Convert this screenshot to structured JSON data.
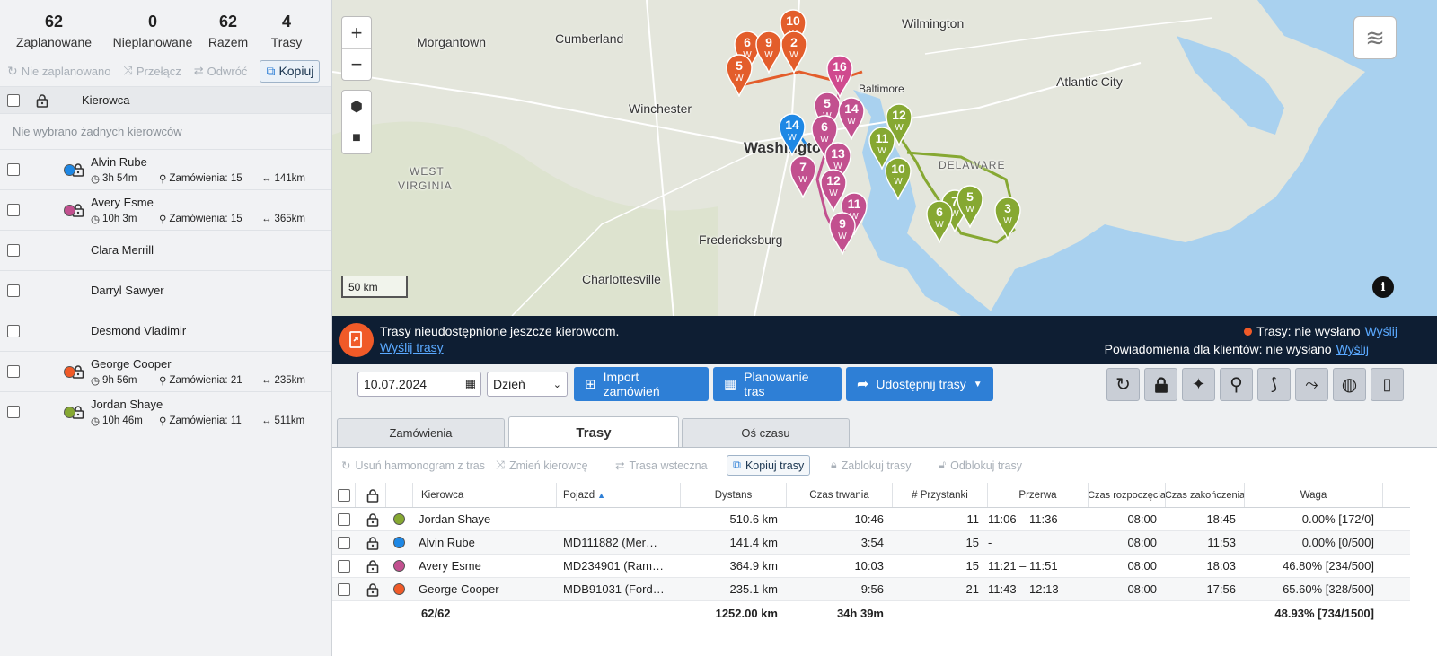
{
  "stats": [
    {
      "value": "62",
      "label": "Zaplanowane"
    },
    {
      "value": "0",
      "label": "Nieplanowane"
    },
    {
      "value": "62",
      "label": "Razem"
    },
    {
      "value": "4",
      "label": "Trasy"
    }
  ],
  "left_toolbar": {
    "unplan": "Nie zaplanowano",
    "toggle": "Przełącz",
    "reverse": "Odwróć",
    "copy": "Kopiuj"
  },
  "left_header": {
    "driver": "Kierowca"
  },
  "no_drivers_msg": "Nie wybrano żadnych kierowców",
  "drivers": [
    {
      "name": "Alvin Rube",
      "color": "#1e88e5",
      "time": "3h 54m",
      "orders": "Zamówienia: 15",
      "dist": "141km"
    },
    {
      "name": "Avery Esme",
      "color": "#c2508f",
      "time": "10h 3m",
      "orders": "Zamówienia: 15",
      "dist": "365km"
    },
    {
      "name": "Clara Merrill"
    },
    {
      "name": "Darryl Sawyer"
    },
    {
      "name": "Desmond Vladimir"
    },
    {
      "name": "George Cooper",
      "color": "#f05a28",
      "time": "9h 56m",
      "orders": "Zamówienia: 21",
      "dist": "235km"
    },
    {
      "name": "Jordan Shaye",
      "color": "#86a832",
      "time": "10h 46m",
      "orders": "Zamówienia: 11",
      "dist": "511km"
    }
  ],
  "map": {
    "cities": [
      "Wilmington",
      "Morgantown",
      "Cumberland",
      "Atlantic City",
      "Winchester",
      "Washington",
      "WEST",
      "VIRGINIA",
      "DELAWARE",
      "Fredericksburg",
      "Charlottesville",
      "Baltimore"
    ],
    "scale": "50 km",
    "pins": [
      {
        "n": "10",
        "c": "#e35d2b"
      },
      {
        "n": "6",
        "c": "#e35d2b"
      },
      {
        "n": "9",
        "c": "#e35d2b"
      },
      {
        "n": "2",
        "c": "#e35d2b"
      },
      {
        "n": "5",
        "c": "#e35d2b"
      },
      {
        "n": "16",
        "c": "#d04a8e"
      },
      {
        "n": "5",
        "c": "#c2508f"
      },
      {
        "n": "14",
        "c": "#c2508f"
      },
      {
        "n": "6",
        "c": "#c2508f"
      },
      {
        "n": "13",
        "c": "#c2508f"
      },
      {
        "n": "7",
        "c": "#c2508f"
      },
      {
        "n": "12",
        "c": "#c2508f"
      },
      {
        "n": "11",
        "c": "#c2508f"
      },
      {
        "n": "9",
        "c": "#c2508f"
      },
      {
        "n": "14",
        "c": "#1e88e5"
      },
      {
        "n": "12",
        "c": "#86a832"
      },
      {
        "n": "11",
        "c": "#86a832"
      },
      {
        "n": "10",
        "c": "#86a832"
      },
      {
        "n": "7",
        "c": "#86a832"
      },
      {
        "n": "5",
        "c": "#86a832"
      },
      {
        "n": "6",
        "c": "#86a832"
      },
      {
        "n": "3",
        "c": "#86a832"
      }
    ],
    "pin_sub": "W"
  },
  "banner": {
    "msg": "Trasy nieudostępnione jeszcze kierowcom.",
    "send_routes": "Wyślij trasy",
    "routes_status": "Trasy: nie wysłano",
    "send": "Wyślij",
    "notif_status": "Powiadomienia dla klientów: nie wysłano",
    "send2": "Wyślij"
  },
  "controls": {
    "date": "10.07.2024",
    "period": "Dzień",
    "import": "Import zamówień",
    "plan": "Planowanie tras",
    "share": "Udostępnij trasy"
  },
  "tabs": [
    "Zamówienia",
    "Trasy",
    "Oś czasu"
  ],
  "route_toolbar": {
    "unschedule": "Usuń harmonogram z tras",
    "change_driver": "Zmień kierowcę",
    "reverse": "Trasa wsteczna",
    "copy": "Kopiuj trasy",
    "lock": "Zablokuj trasy",
    "unlock": "Odblokuj trasy"
  },
  "table": {
    "headers": [
      "Kierowca",
      "Pojazd",
      "Dystans",
      "Czas trwania",
      "# Przystanki",
      "Przerwa",
      "Czas rozpoczęcia",
      "Czas zakończenia",
      "Waga"
    ],
    "rows": [
      {
        "color": "#86a832",
        "driver": "Jordan Shaye",
        "vehicle": "",
        "dist": "510.6 km",
        "dur": "10:46",
        "stops": "11",
        "brk": "11:06 – 11:36",
        "start": "08:00",
        "end": "18:45",
        "weight": "0.00% [172/0]"
      },
      {
        "color": "#1e88e5",
        "driver": "Alvin Rube",
        "vehicle": "MD111882 (Mer…",
        "dist": "141.4 km",
        "dur": "3:54",
        "stops": "15",
        "brk": "-",
        "start": "08:00",
        "end": "11:53",
        "weight": "0.00% [0/500]"
      },
      {
        "color": "#c2508f",
        "driver": "Avery Esme",
        "vehicle": "MD234901 (Ram…",
        "dist": "364.9 km",
        "dur": "10:03",
        "stops": "15",
        "brk": "11:21 – 11:51",
        "start": "08:00",
        "end": "18:03",
        "weight": "46.80% [234/500]"
      },
      {
        "color": "#f05a28",
        "driver": "George Cooper",
        "vehicle": "MDB91031 (Ford…",
        "dist": "235.1 km",
        "dur": "9:56",
        "stops": "21",
        "brk": "11:43 – 12:13",
        "start": "08:00",
        "end": "17:56",
        "weight": "65.60% [328/500]"
      }
    ],
    "totals": {
      "count": "62/62",
      "dist": "1252.00 km",
      "dur": "34h 39m",
      "weight": "48.93% [734/1500]"
    }
  }
}
